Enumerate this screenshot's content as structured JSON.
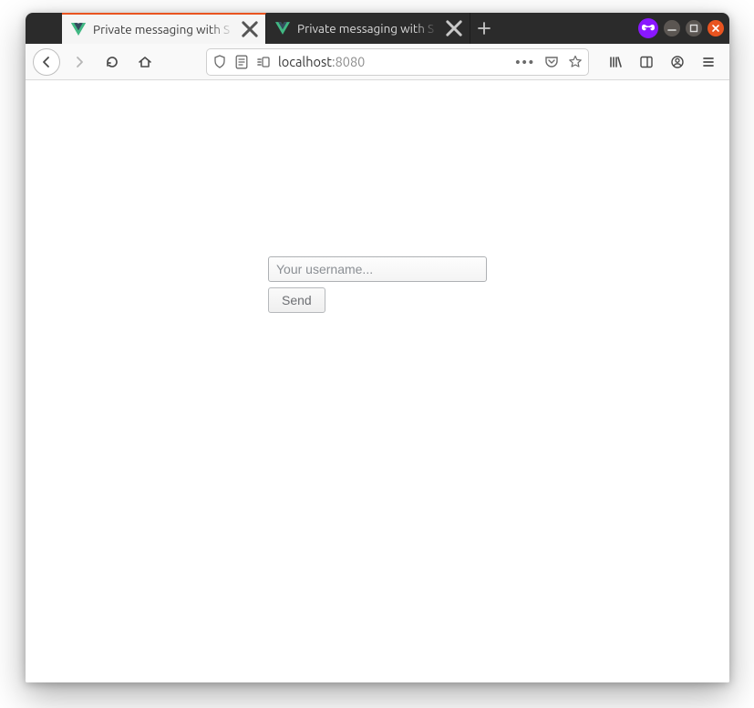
{
  "tabs": [
    {
      "title": "Private messaging with S",
      "active": true
    },
    {
      "title": "Private messaging with S",
      "active": false
    }
  ],
  "address": {
    "host": "localhost",
    "port": ":8080"
  },
  "content": {
    "username_placeholder": "Your username...",
    "username_value": "",
    "send_label": "Send"
  },
  "glyphs": {
    "ellipsis": "•••"
  }
}
